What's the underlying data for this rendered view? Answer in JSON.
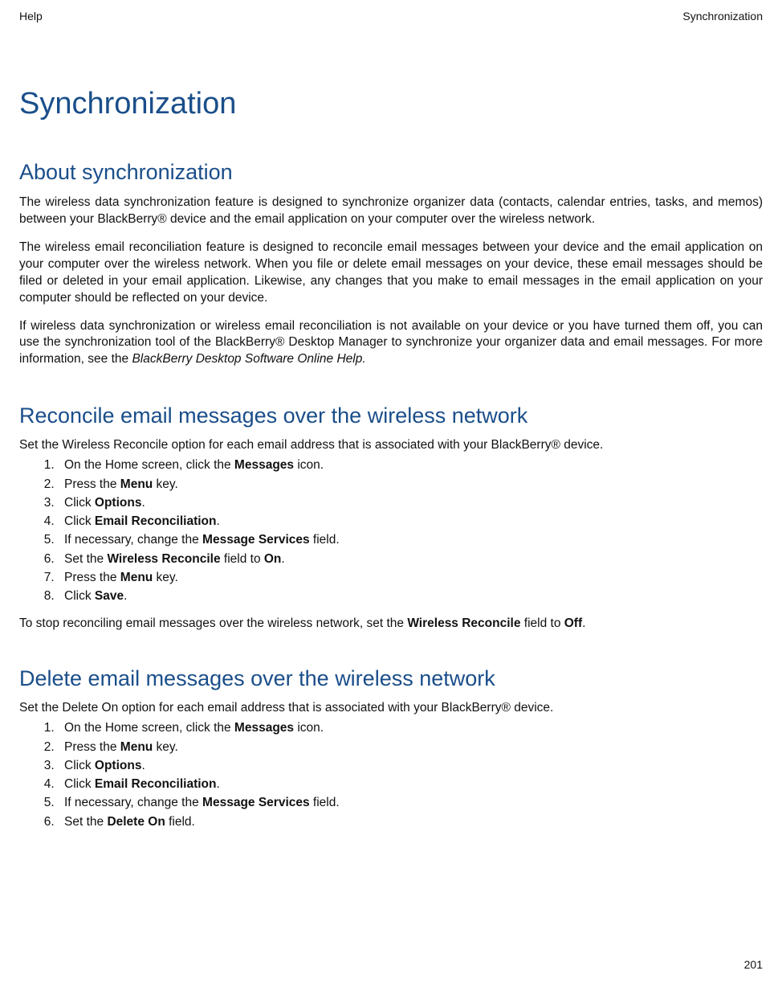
{
  "header": {
    "left": "Help",
    "right": "Synchronization"
  },
  "page_title": "Synchronization",
  "section_about": {
    "title": "About synchronization",
    "p1": "The wireless data synchronization feature is designed to synchronize organizer data (contacts, calendar entries, tasks, and memos) between your BlackBerry® device and the email application on your computer over the wireless network.",
    "p2": "The wireless email reconciliation feature is designed to reconcile email messages between your device and the email application on your computer over the wireless network. When you file or delete email messages on your device, these email messages should be filed or deleted in your email application. Likewise, any changes that you make to email messages in the email application on your computer should be reflected on your device.",
    "p3_pre": "If wireless data synchronization or wireless email reconciliation is not available on your device or you have turned them off, you can use the synchronization tool of the BlackBerry® Desktop Manager to synchronize your organizer data and email messages. For more information, see the  ",
    "p3_italic": "BlackBerry Desktop Software Online Help.",
    "p3_post": ""
  },
  "section_reconcile": {
    "title": "Reconcile email messages over the wireless network",
    "intro": "Set the Wireless Reconcile option for each email address that is associated with your BlackBerry® device.",
    "steps": [
      {
        "pre": "On the Home screen, click the ",
        "bold": "Messages",
        "post": " icon."
      },
      {
        "pre": "Press the ",
        "bold": "Menu",
        "post": " key."
      },
      {
        "pre": "Click ",
        "bold": "Options",
        "post": "."
      },
      {
        "pre": "Click ",
        "bold": "Email Reconciliation",
        "post": "."
      },
      {
        "pre": "If necessary, change the ",
        "bold": "Message Services",
        "post": " field."
      },
      {
        "pre": "Set the ",
        "bold": "Wireless Reconcile",
        "post": " field to ",
        "bold2": "On",
        "post2": "."
      },
      {
        "pre": "Press the ",
        "bold": "Menu",
        "post": " key."
      },
      {
        "pre": "Click ",
        "bold": "Save",
        "post": "."
      }
    ],
    "after_pre": "To stop reconciling email messages over the wireless network, set the ",
    "after_b1": "Wireless Reconcile",
    "after_mid": " field to ",
    "after_b2": "Off",
    "after_post": "."
  },
  "section_delete": {
    "title": "Delete email messages over the wireless network",
    "intro": "Set the Delete On option for each email address that is associated with your BlackBerry® device.",
    "steps": [
      {
        "pre": "On the Home screen, click the ",
        "bold": "Messages",
        "post": " icon."
      },
      {
        "pre": "Press the ",
        "bold": "Menu",
        "post": " key."
      },
      {
        "pre": "Click ",
        "bold": "Options",
        "post": "."
      },
      {
        "pre": "Click ",
        "bold": "Email Reconciliation",
        "post": "."
      },
      {
        "pre": "If necessary, change the ",
        "bold": "Message Services",
        "post": " field."
      },
      {
        "pre": "Set the ",
        "bold": "Delete On",
        "post": " field."
      }
    ]
  },
  "page_number": "201"
}
